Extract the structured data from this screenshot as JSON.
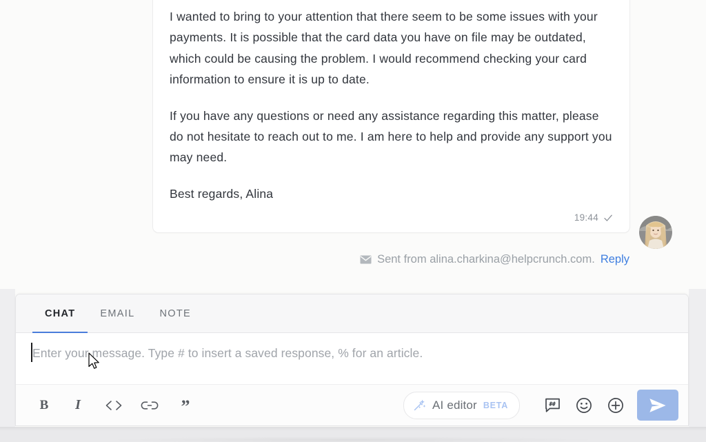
{
  "conversation": {
    "message": {
      "paragraphs": [
        "I wanted to bring to your attention that there seem to be some issues with your payments. It is possible that the card data you have on file may be outdated, which could be causing the problem. I would recommend checking your card information to ensure it is up to date.",
        "If you have any questions or need any assistance regarding this matter, please do not hesitate to reach out to me. I am here to help and provide any support you may need.",
        "Best regards, Alina"
      ],
      "timestamp": "19:44",
      "status_icon": "check-icon",
      "avatar_icon": "agent-avatar"
    },
    "sent_from": {
      "icon": "envelope-icon",
      "text": "Sent from alina.charkina@helpcrunch.com.",
      "reply_label": "Reply",
      "reply_color": "#3f7fe0"
    }
  },
  "composer": {
    "tabs": [
      {
        "label": "CHAT",
        "active": true
      },
      {
        "label": "EMAIL",
        "active": false
      },
      {
        "label": "NOTE",
        "active": false
      }
    ],
    "active_tab_accent": "#4a7ddb",
    "input": {
      "value": "",
      "placeholder": "Enter your message. Type # to insert a saved response, % for an article."
    },
    "toolbar": {
      "format_buttons": [
        {
          "name": "bold-button",
          "glyph": "B"
        },
        {
          "name": "italic-button",
          "glyph": "I"
        },
        {
          "name": "code-button",
          "glyph": "<>"
        },
        {
          "name": "link-button",
          "glyph": "link-icon"
        },
        {
          "name": "quote-button",
          "glyph": "”"
        }
      ],
      "ai_editor": {
        "icon": "magic-wand-icon",
        "label": "AI editor",
        "badge": "BETA",
        "badge_color": "#a9c3f2"
      },
      "actions": [
        {
          "name": "saved-response-button",
          "icon": "hash-bubble-icon"
        },
        {
          "name": "emoji-button",
          "icon": "smiley-icon"
        },
        {
          "name": "attachment-button",
          "icon": "plus-circle-icon"
        }
      ],
      "send_button": {
        "icon": "send-plane-icon",
        "color": "#9cb8e8"
      }
    }
  }
}
